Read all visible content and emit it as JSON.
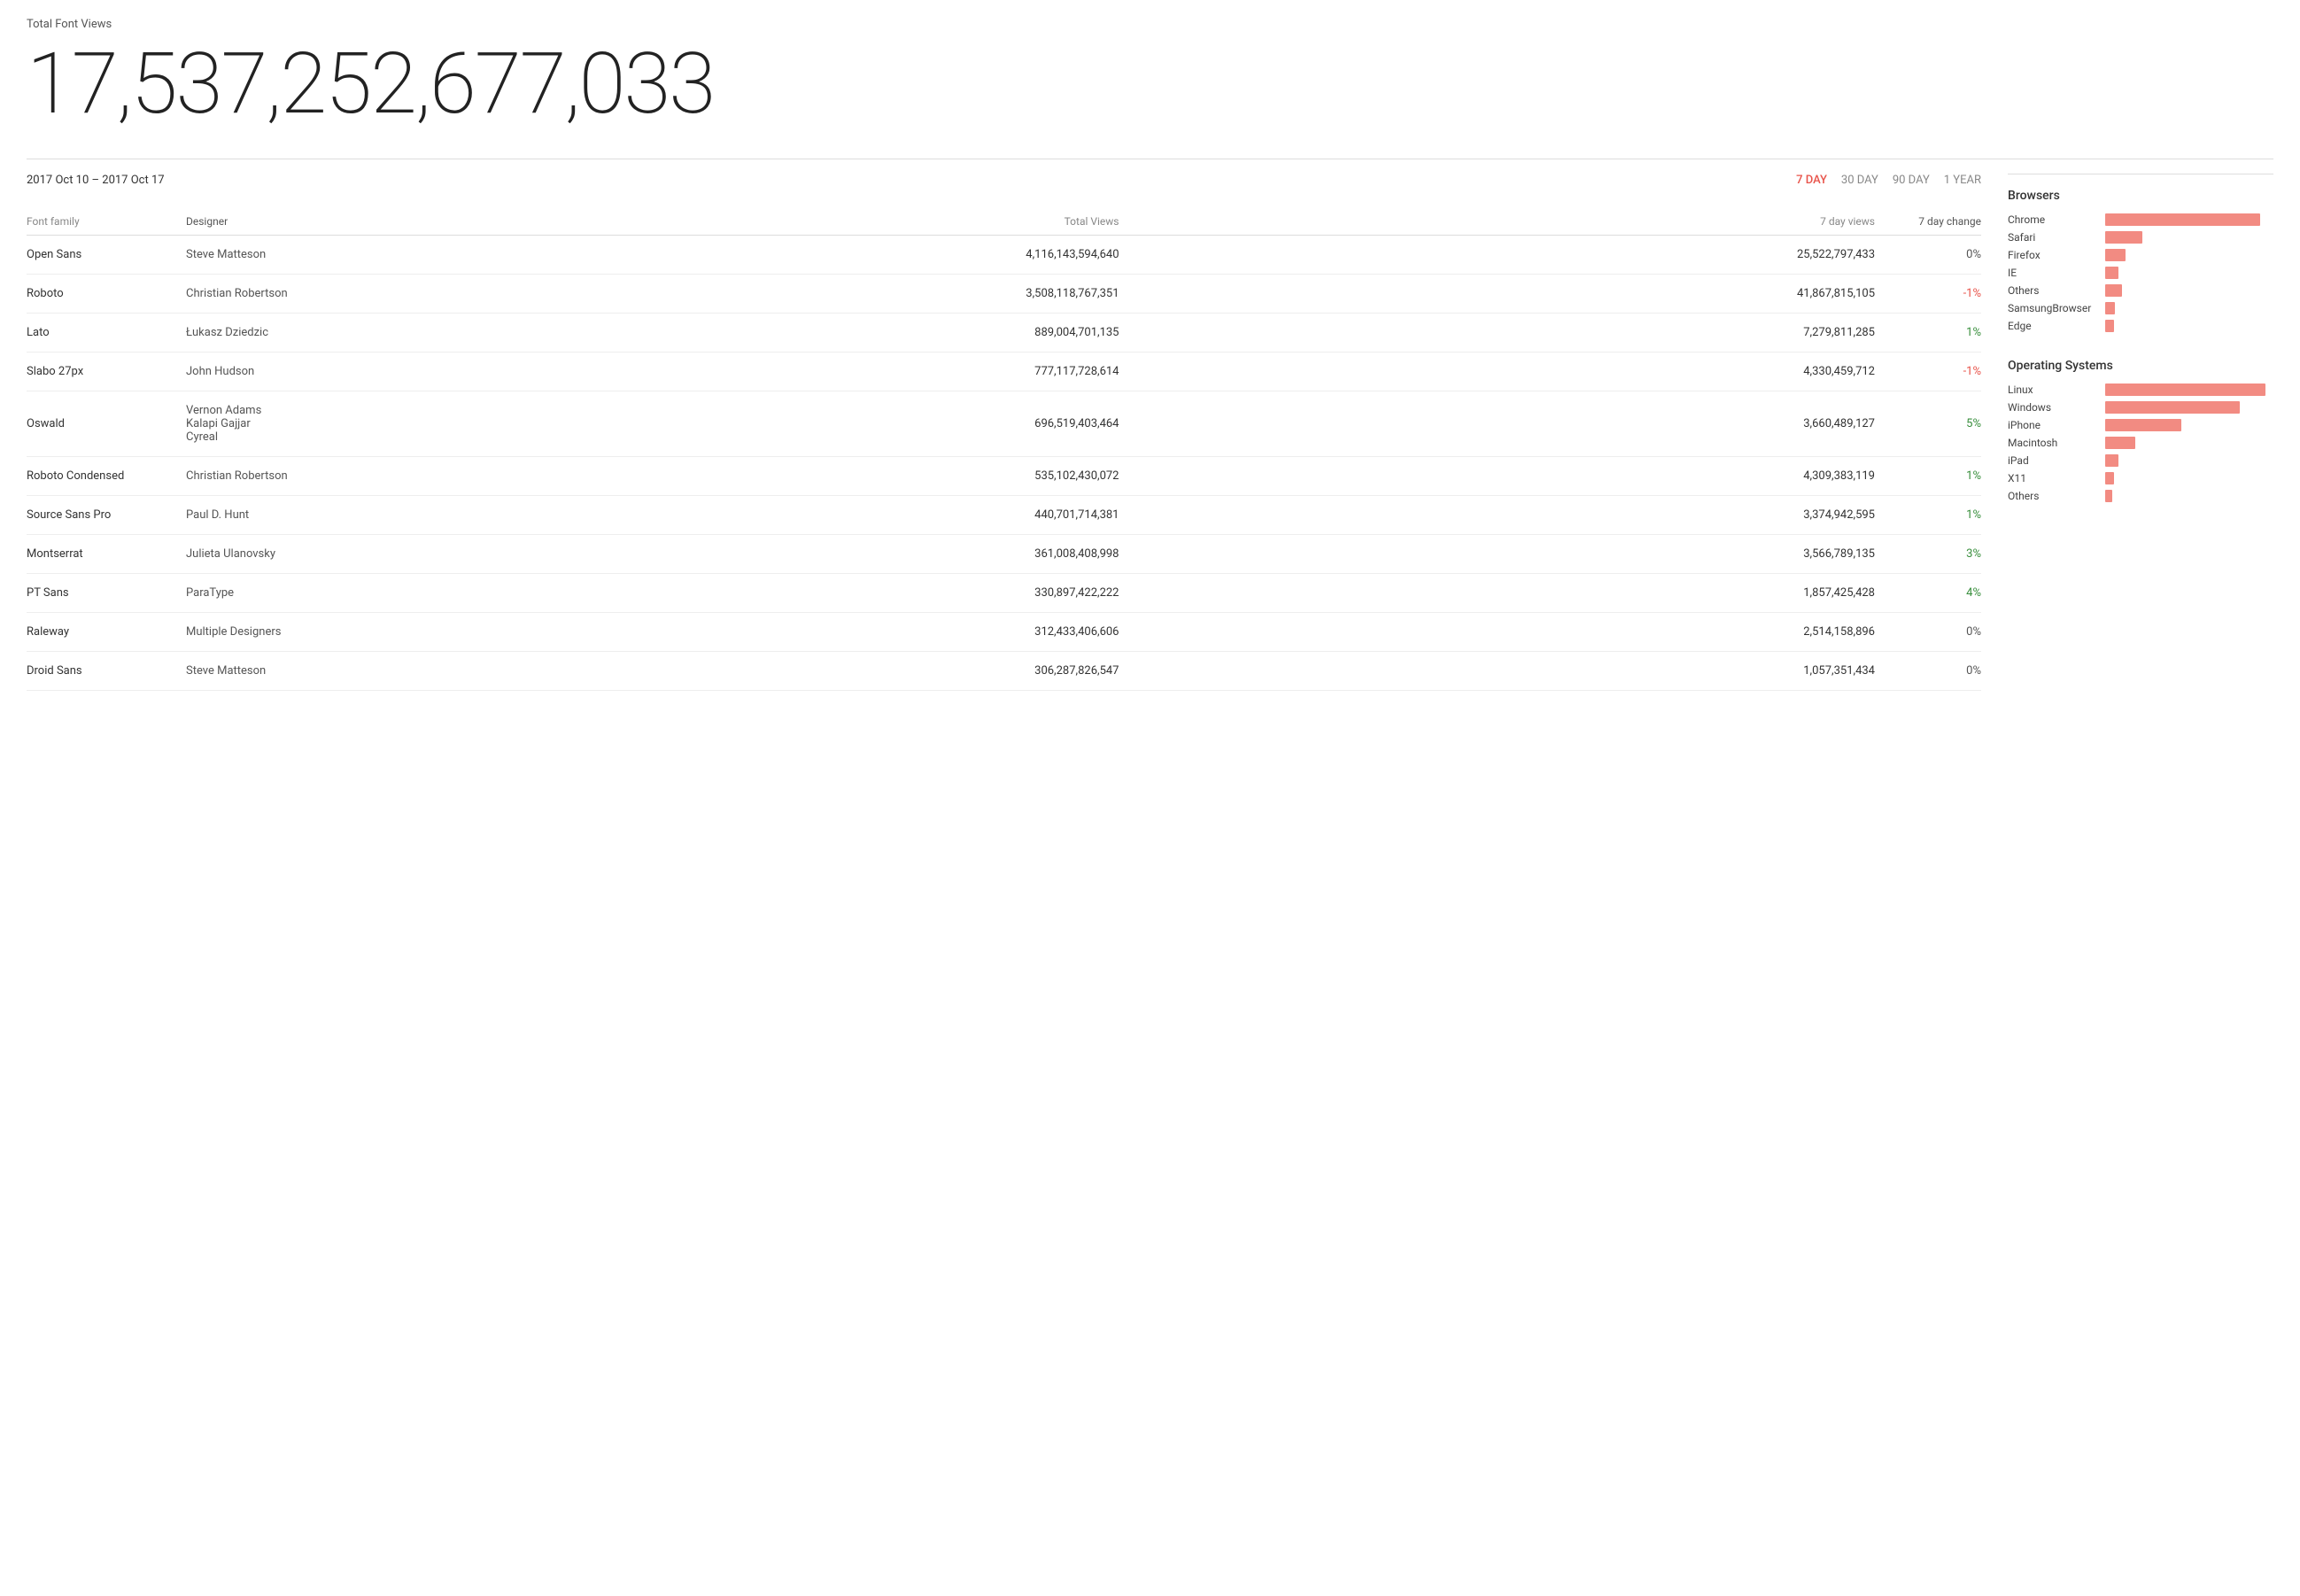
{
  "header": {
    "total_label": "Total Font Views",
    "total_number": "17,537,252,677,033"
  },
  "date_range": {
    "text": "2017 Oct 10 – 2017 Oct 17"
  },
  "time_filters": [
    {
      "label": "7 DAY",
      "active": true
    },
    {
      "label": "30 DAY",
      "active": false
    },
    {
      "label": "90 DAY",
      "active": false
    },
    {
      "label": "1 YEAR",
      "active": false
    }
  ],
  "table": {
    "headers": [
      "Font family",
      "Designer",
      "Total Views",
      "7 day views",
      "7 day change"
    ],
    "rows": [
      {
        "font": "Open Sans",
        "designer": "Steve Matteson",
        "total": "4,116,143,594,640",
        "seven_day": "25,522,797,433",
        "change": "0%",
        "change_type": "neutral"
      },
      {
        "font": "Roboto",
        "designer": "Christian Robertson",
        "total": "3,508,118,767,351",
        "seven_day": "41,867,815,105",
        "change": "-1%",
        "change_type": "negative"
      },
      {
        "font": "Lato",
        "designer": "Łukasz Dziedzic",
        "total": "889,004,701,135",
        "seven_day": "7,279,811,285",
        "change": "1%",
        "change_type": "positive"
      },
      {
        "font": "Slabo 27px",
        "designer": "John Hudson",
        "total": "777,117,728,614",
        "seven_day": "4,330,459,712",
        "change": "-1%",
        "change_type": "negative"
      },
      {
        "font": "Oswald",
        "designer": "Vernon Adams\nKalapi Gajjar\nCyreal",
        "total": "696,519,403,464",
        "seven_day": "3,660,489,127",
        "change": "5%",
        "change_type": "positive"
      },
      {
        "font": "Roboto Condensed",
        "designer": "Christian Robertson",
        "total": "535,102,430,072",
        "seven_day": "4,309,383,119",
        "change": "1%",
        "change_type": "positive"
      },
      {
        "font": "Source Sans Pro",
        "designer": "Paul D. Hunt",
        "total": "440,701,714,381",
        "seven_day": "3,374,942,595",
        "change": "1%",
        "change_type": "positive"
      },
      {
        "font": "Montserrat",
        "designer": "Julieta Ulanovsky",
        "total": "361,008,408,998",
        "seven_day": "3,566,789,135",
        "change": "3%",
        "change_type": "positive"
      },
      {
        "font": "PT Sans",
        "designer": "ParaType",
        "total": "330,897,422,222",
        "seven_day": "1,857,425,428",
        "change": "4%",
        "change_type": "positive"
      },
      {
        "font": "Raleway",
        "designer": "Multiple Designers",
        "total": "312,433,406,606",
        "seven_day": "2,514,158,896",
        "change": "0%",
        "change_type": "neutral"
      },
      {
        "font": "Droid Sans",
        "designer": "Steve Matteson",
        "total": "306,287,826,547",
        "seven_day": "1,057,351,434",
        "change": "0%",
        "change_type": "neutral"
      }
    ]
  },
  "browsers": {
    "title": "Browsers",
    "items": [
      {
        "label": "Chrome",
        "pct": 92
      },
      {
        "label": "Safari",
        "pct": 22
      },
      {
        "label": "Firefox",
        "pct": 12
      },
      {
        "label": "IE",
        "pct": 8
      },
      {
        "label": "Others",
        "pct": 10
      },
      {
        "label": "SamsungBrowser",
        "pct": 6
      },
      {
        "label": "Edge",
        "pct": 5
      }
    ]
  },
  "os": {
    "title": "Operating Systems",
    "items": [
      {
        "label": "Linux",
        "pct": 95
      },
      {
        "label": "Windows",
        "pct": 80
      },
      {
        "label": "iPhone",
        "pct": 45
      },
      {
        "label": "Macintosh",
        "pct": 18
      },
      {
        "label": "iPad",
        "pct": 8
      },
      {
        "label": "X11",
        "pct": 5
      },
      {
        "label": "Others",
        "pct": 4
      }
    ]
  }
}
